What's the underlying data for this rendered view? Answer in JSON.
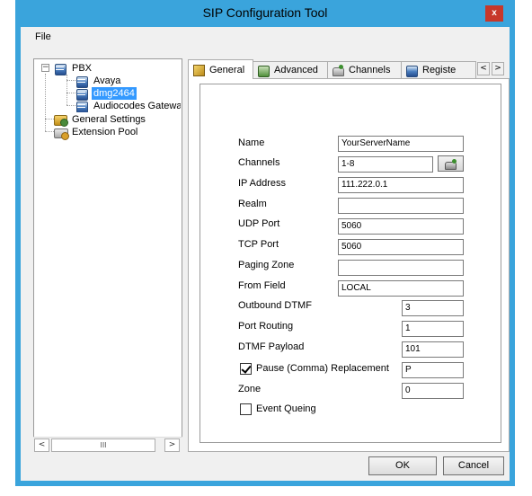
{
  "window": {
    "title": "SIP Configuration Tool",
    "close_glyph": "x",
    "accent_color": "#3aa4dc"
  },
  "menu": {
    "file": "File"
  },
  "tree": {
    "root": "PBX",
    "children": [
      "Avaya",
      "dmg2464",
      "Audiocodes Gateway"
    ],
    "selected": "dmg2464",
    "general_settings": "General Settings",
    "extension_pool": "Extension Pool",
    "expander_glyph": "−",
    "scroll_left": "<",
    "scroll_right": ">",
    "scroll_grip": "III"
  },
  "tabs": {
    "items": [
      "General",
      "Advanced",
      "Channels",
      "Registe"
    ],
    "active": "General",
    "scroll_left": "<",
    "scroll_right": ">"
  },
  "form": {
    "name_label": "Name",
    "name_value": "YourServerName",
    "channels_label": "Channels",
    "channels_value": "1-8",
    "ip_label": "IP Address",
    "ip_value": "111.222.0.1",
    "realm_label": "Realm",
    "realm_value": "",
    "udp_label": "UDP Port",
    "udp_value": "5060",
    "tcp_label": "TCP Port",
    "tcp_value": "5060",
    "paging_label": "Paging Zone",
    "paging_value": "",
    "from_label": "From Field",
    "from_value": "LOCAL",
    "dtmf_label": "Outbound DTMF",
    "dtmf_value": "3",
    "routing_label": "Port Routing",
    "routing_value": "1",
    "payload_label": "DTMF Payload",
    "payload_value": "101",
    "pause_label": "Pause (Comma) Replacement",
    "pause_checked": true,
    "pause_value": "P",
    "zone_label": "Zone",
    "zone_value": "0",
    "event_label": "Event Queing",
    "event_checked": false
  },
  "buttons": {
    "ok": "OK",
    "cancel": "Cancel"
  }
}
